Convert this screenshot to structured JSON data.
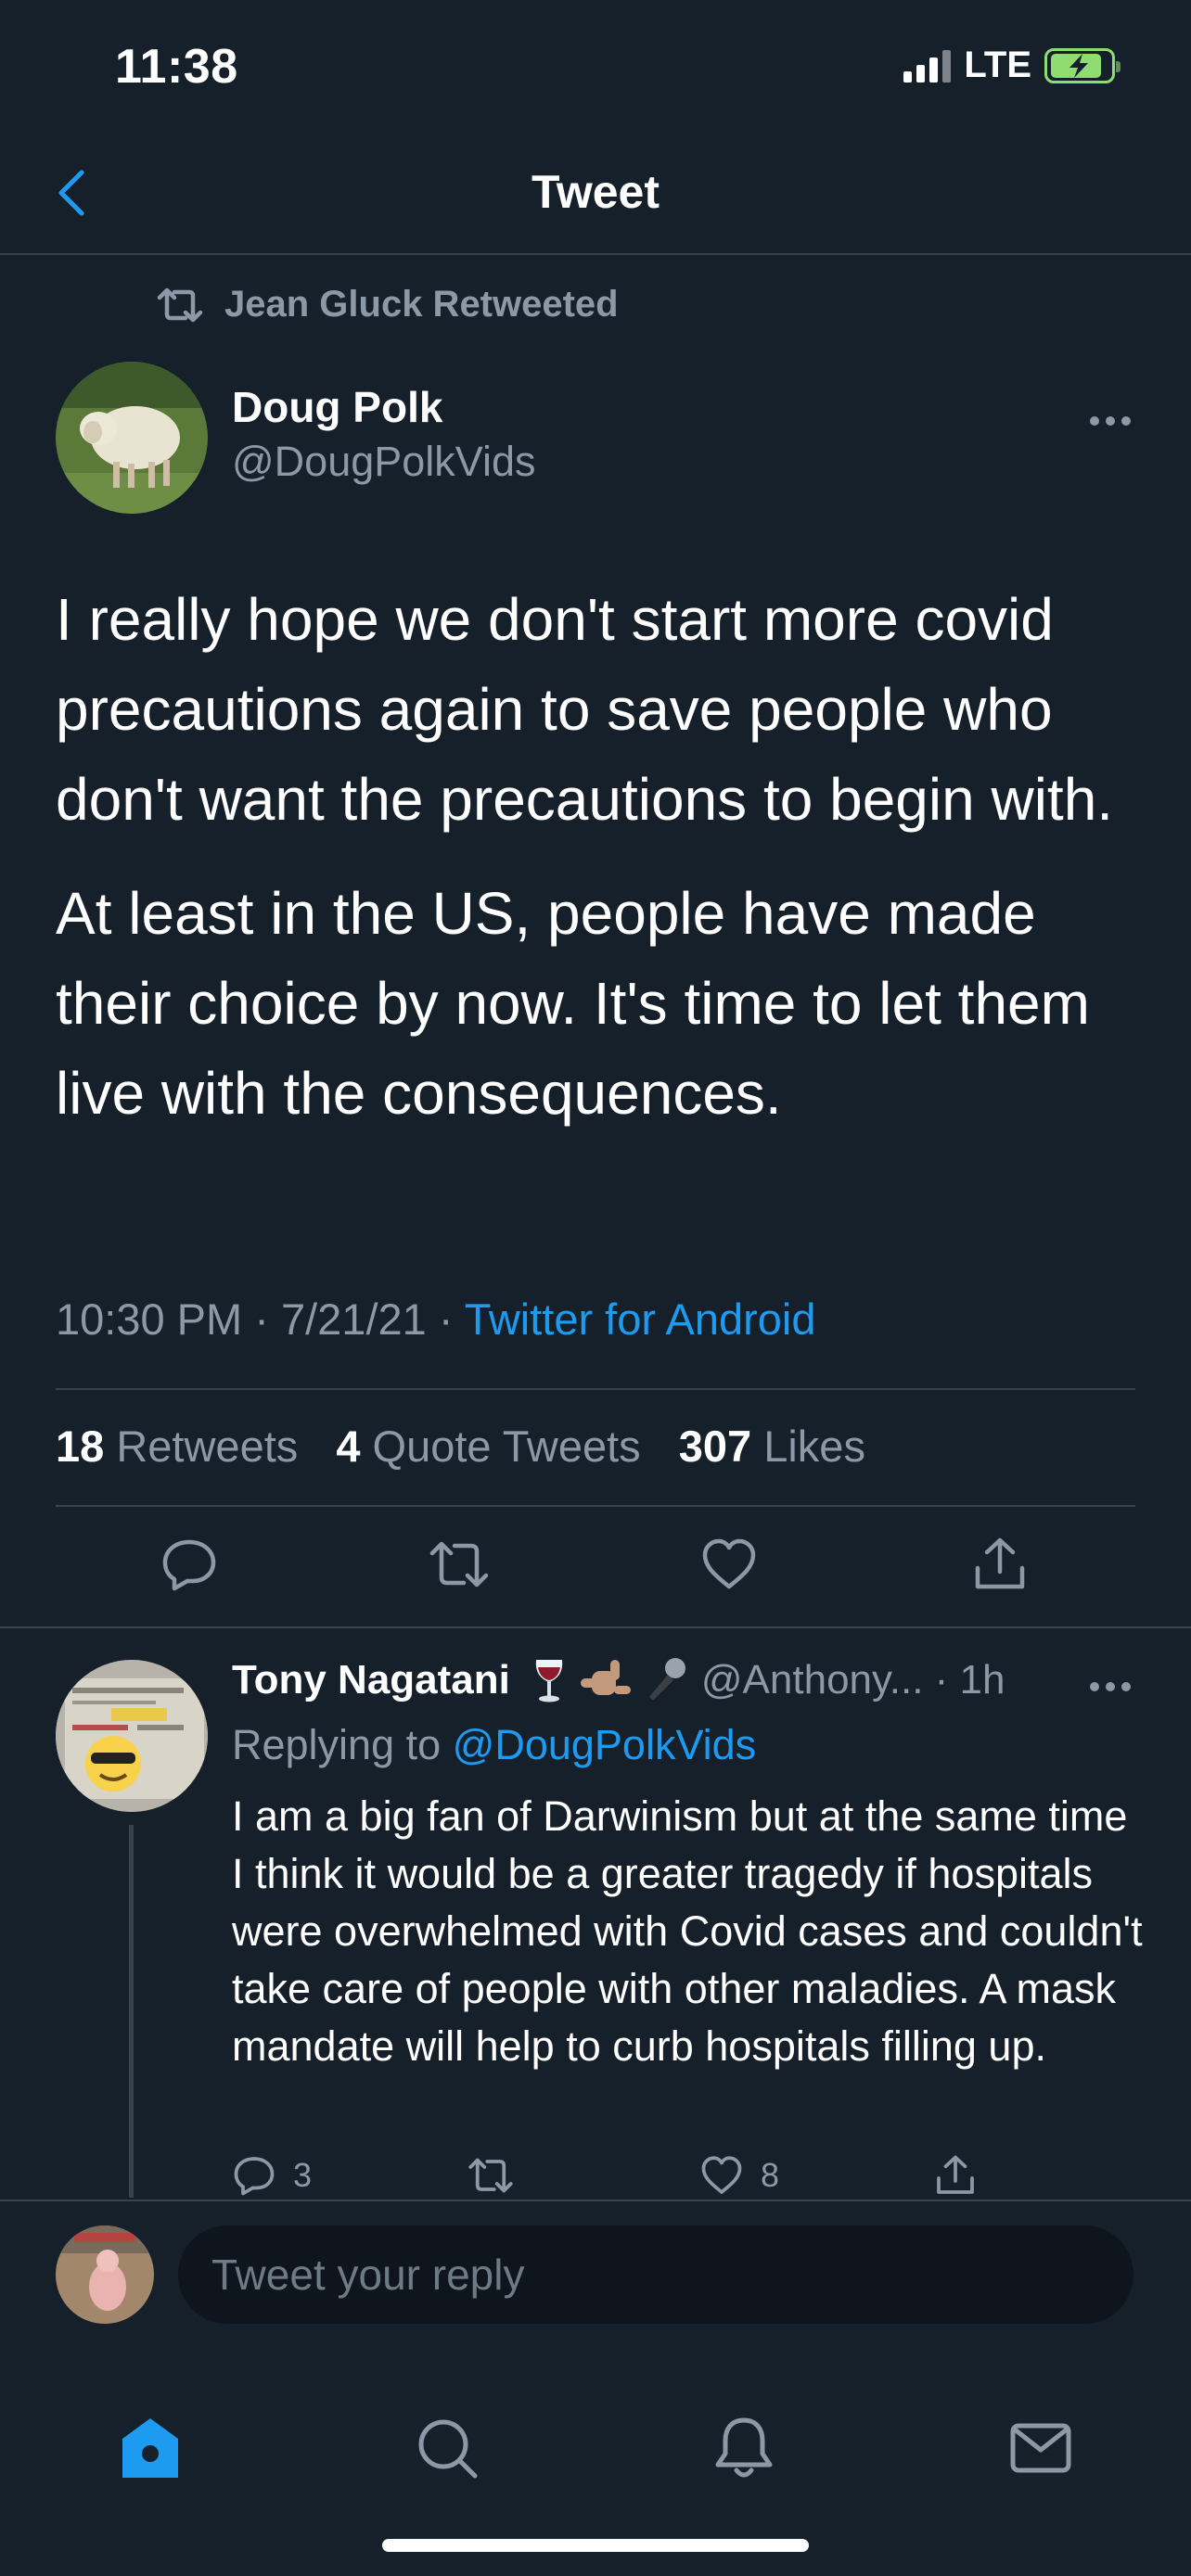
{
  "status_bar": {
    "time": "11:38",
    "network": "LTE"
  },
  "header": {
    "title": "Tweet"
  },
  "retweet_context": {
    "label": "Jean Gluck Retweeted"
  },
  "tweet": {
    "author_name": "Doug Polk",
    "author_handle": "@DougPolkVids",
    "paragraphs": [
      "I really hope we don't start more covid precautions again to save people who don't want the precautions to begin with.",
      "At least in the US, people have made their choice by now. It's time to let them live with the consequences."
    ],
    "time": "10:30 PM",
    "date": "7/21/21",
    "source": "Twitter for Android",
    "stats": {
      "retweets_count": "18",
      "retweets_label": "Retweets",
      "quotes_count": "4",
      "quotes_label": "Quote Tweets",
      "likes_count": "307",
      "likes_label": "Likes"
    }
  },
  "reply": {
    "author_name": "Tony Nagatani",
    "author_handle": "@Anthony...",
    "age": "1h",
    "replying_prefix": "Replying to",
    "replying_to": "@DougPolkVids",
    "text": "I am a big fan of Darwinism but at the same time I think it would be a greater tragedy if hospitals were overwhelmed with Covid cases and couldn't take care of people with other maladies. A mask mandate will help to curb hospitals filling up.",
    "reply_count": "3",
    "like_count": "8",
    "emojis": [
      "wine-glass",
      "call-me-hand",
      "microphone"
    ]
  },
  "composer": {
    "placeholder": "Tweet your reply"
  },
  "tabbar": {
    "items": [
      "home",
      "search",
      "notifications",
      "messages"
    ],
    "active": "home"
  },
  "colors": {
    "background": "#15202b",
    "accent": "#1d9bf0",
    "muted": "#8b98a5",
    "divider": "#38444d"
  }
}
